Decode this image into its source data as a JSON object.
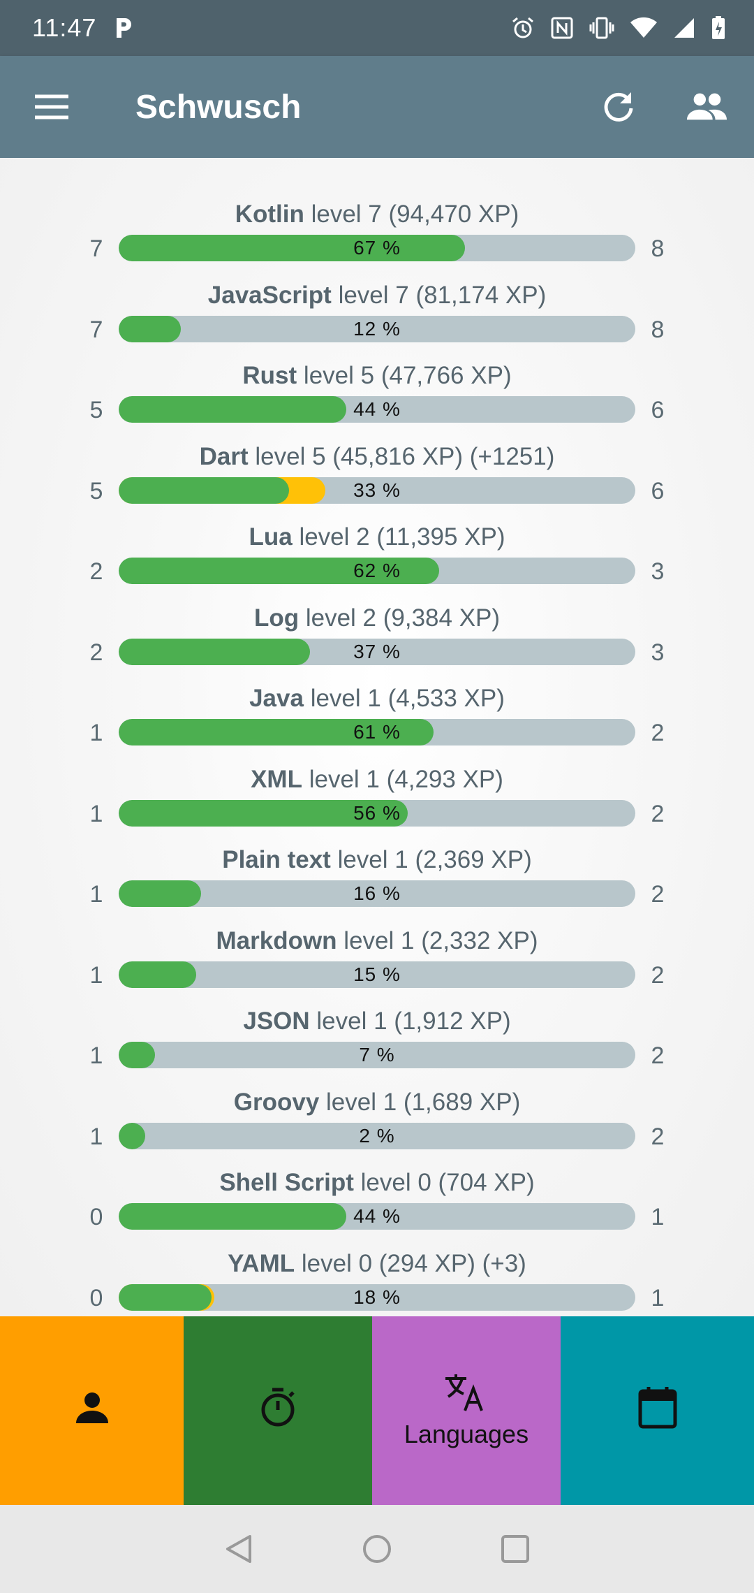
{
  "status_bar": {
    "time": "11:47",
    "icons": [
      "parking-icon",
      "alarm-icon",
      "nfc-icon",
      "vibrate-icon",
      "wifi-icon",
      "signal-icon",
      "battery-charging-icon"
    ]
  },
  "app_bar": {
    "title": "Schwusch",
    "menu_icon": "menu-icon",
    "actions": [
      "refresh-icon",
      "people-icon"
    ]
  },
  "languages": [
    {
      "name": "Kotlin",
      "detail": "level 7 (94,470 XP)",
      "from": "7",
      "to": "8",
      "percent_label": "67 %",
      "progress": 0.67,
      "gain": 0
    },
    {
      "name": "JavaScript",
      "detail": "level 7 (81,174 XP)",
      "from": "7",
      "to": "8",
      "percent_label": "12 %",
      "progress": 0.12,
      "gain": 0
    },
    {
      "name": "Rust",
      "detail": "level 5 (47,766 XP)",
      "from": "5",
      "to": "6",
      "percent_label": "44 %",
      "progress": 0.44,
      "gain": 0
    },
    {
      "name": "Dart",
      "detail": "level 5 (45,816 XP) (+1251)",
      "from": "5",
      "to": "6",
      "percent_label": "33 %",
      "progress": 0.33,
      "gain": 0.07
    },
    {
      "name": "Lua",
      "detail": "level 2 (11,395 XP)",
      "from": "2",
      "to": "3",
      "percent_label": "62 %",
      "progress": 0.62,
      "gain": 0
    },
    {
      "name": "Log",
      "detail": "level 2 (9,384 XP)",
      "from": "2",
      "to": "3",
      "percent_label": "37 %",
      "progress": 0.37,
      "gain": 0
    },
    {
      "name": "Java",
      "detail": "level 1 (4,533 XP)",
      "from": "1",
      "to": "2",
      "percent_label": "61 %",
      "progress": 0.61,
      "gain": 0
    },
    {
      "name": "XML",
      "detail": "level 1 (4,293 XP)",
      "from": "1",
      "to": "2",
      "percent_label": "56 %",
      "progress": 0.56,
      "gain": 0
    },
    {
      "name": "Plain text",
      "detail": "level 1 (2,369 XP)",
      "from": "1",
      "to": "2",
      "percent_label": "16 %",
      "progress": 0.16,
      "gain": 0
    },
    {
      "name": "Markdown",
      "detail": "level 1 (2,332 XP)",
      "from": "1",
      "to": "2",
      "percent_label": "15 %",
      "progress": 0.15,
      "gain": 0
    },
    {
      "name": "JSON",
      "detail": "level 1 (1,912 XP)",
      "from": "1",
      "to": "2",
      "percent_label": "7 %",
      "progress": 0.07,
      "gain": 0
    },
    {
      "name": "Groovy",
      "detail": "level 1 (1,689 XP)",
      "from": "1",
      "to": "2",
      "percent_label": "2 %",
      "progress": 0.02,
      "gain": 0
    },
    {
      "name": "Shell Script",
      "detail": "level 0 (704 XP)",
      "from": "0",
      "to": "1",
      "percent_label": "44 %",
      "progress": 0.44,
      "gain": 0
    },
    {
      "name": "YAML",
      "detail": "level 0 (294 XP) (+3)",
      "from": "0",
      "to": "1",
      "percent_label": "18 %",
      "progress": 0.18,
      "gain": 0.005
    }
  ],
  "bottom_nav": [
    {
      "icon": "person-icon",
      "label": "",
      "color": "#ff9e00",
      "active": false
    },
    {
      "icon": "stopwatch-icon",
      "label": "",
      "color": "#2e7d32",
      "active": false
    },
    {
      "icon": "translate-icon",
      "label": "Languages",
      "color": "#ba68c8",
      "active": true
    },
    {
      "icon": "calendar-icon",
      "label": "",
      "color": "#0097a7",
      "active": false
    }
  ],
  "colors": {
    "status_bar": "#4f626c",
    "app_bar": "#607d8b",
    "progress_fill": "#4caf50",
    "progress_gain": "#ffc107",
    "progress_track": "#b8c6cb"
  },
  "system_nav": [
    "back-icon",
    "home-icon",
    "recents-icon"
  ]
}
